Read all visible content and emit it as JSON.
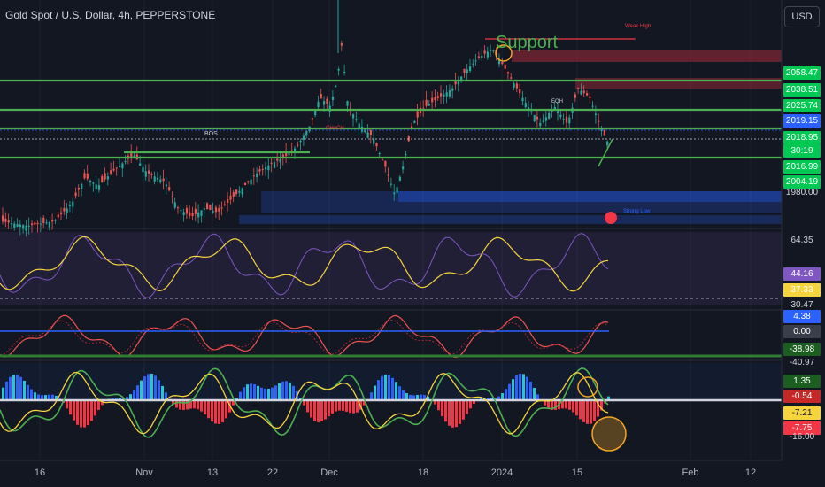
{
  "header": {
    "title": "Gold Spot / U.S. Dollar, 4h, PEPPERSTONE",
    "currency": "USD"
  },
  "chart_data": [
    {
      "type": "candlestick",
      "title": "Gold Spot / U.S. Dollar, 4h, PEPPERSTONE",
      "x_ticks": [
        "16",
        "Nov",
        "13",
        "22",
        "Dec",
        "18",
        "2024",
        "15",
        "Feb",
        "12"
      ],
      "price_ticks": [
        "1980.00"
      ],
      "price_labels": [
        {
          "text": "2058.47",
          "color": "#00c853"
        },
        {
          "text": "2038.51",
          "color": "#00c853"
        },
        {
          "text": "2025.74",
          "color": "#00c853"
        },
        {
          "text": "2019.15",
          "color": "#2962ff"
        },
        {
          "text": "2018.95",
          "color": "#00c853"
        },
        {
          "text": "30:19",
          "color": "#00c853"
        },
        {
          "text": "2016.99",
          "color": "#00c853"
        },
        {
          "text": "2004.19",
          "color": "#00c853"
        }
      ],
      "annotations": [
        "Support",
        "Weak High",
        "Strong Low",
        "BOS",
        "CHoCH",
        "EQH"
      ],
      "colors": {
        "up": "#26a69a",
        "down": "#ef5350",
        "levels": "#4caf50"
      }
    },
    {
      "type": "line",
      "name": "oscillator_1",
      "values_shown": [
        "64.35",
        "44.16",
        "37.33",
        "30.47"
      ],
      "colors": [
        "#7e57c2",
        "#f5d43d"
      ]
    },
    {
      "type": "line",
      "name": "oscillator_2",
      "values_shown": [
        "4.38",
        "0.00",
        "-38.98",
        "-40.97"
      ],
      "colors": [
        "#ef5350",
        "#2962ff"
      ]
    },
    {
      "type": "bar",
      "name": "oscillator_3",
      "values_shown": [
        "1.35",
        "-0.54",
        "-7.21",
        "-7.75",
        "-16.00"
      ],
      "colors": [
        "#26c6da",
        "#f23645",
        "#4caf50",
        "#f5d43d"
      ]
    }
  ]
}
